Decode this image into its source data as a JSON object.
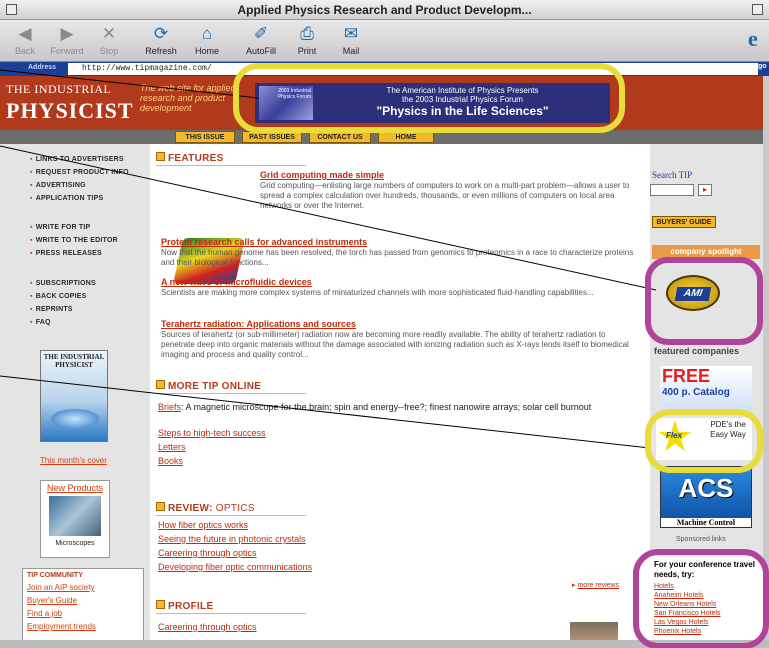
{
  "window": {
    "title": "Applied Physics Research and Product Developm..."
  },
  "toolbar": {
    "back": "Back",
    "forward": "Forward",
    "stop": "Stop",
    "refresh": "Refresh",
    "home": "Home",
    "autofill": "AutoFill",
    "print": "Print",
    "mail": "Mail"
  },
  "address": {
    "label": "Address",
    "url": "http://www.tipmagazine.com/",
    "go": "go"
  },
  "header": {
    "logo_line1": "THE INDUSTRIAL",
    "logo_line2": "PHYSICIST",
    "tagline": "The web site for applied research and product development",
    "banner_small": "2003 Industrial Physics Forum",
    "banner_line1": "The American Institute of Physics Presents",
    "banner_line2": "the 2003 Industrial Physics Forum",
    "banner_line3": "\"Physics in the Life Sciences\""
  },
  "nav": [
    "THIS ISSUE",
    "PAST ISSUES",
    "CONTACT US",
    "HOME"
  ],
  "sidebar": {
    "links_group1": [
      "LINKS TO ADVERTISERS",
      "REQUEST PRODUCT INFO",
      "ADVERTISING",
      "APPLICATION TIPS"
    ],
    "links_group2": [
      "WRITE FOR TIP",
      "WRITE TO THE EDITOR",
      "PRESS RELEASES"
    ],
    "links_group3": [
      "SUBSCRIPTIONS",
      "BACK COPIES",
      "REPRINTS",
      "FAQ"
    ],
    "cover_title": "THE INDUSTRIAL PHYSICIST",
    "cover_caption": "This month's cover",
    "new_products_title": "New Products",
    "new_products_caption": "Microscopes",
    "community_heading": "TIP COMMUNITY",
    "community_links": [
      "Join an AIP society",
      "Buyer's Guide",
      "Find a job",
      "Employment trends"
    ]
  },
  "main": {
    "features_heading": "FEATURES",
    "articles": [
      {
        "title": "Grid computing made simple",
        "desc": "Grid computing—enlisting large numbers of computers to work on a multi-part problem—allows a user to spread a complex calculation over hundreds, thousands, or even millions of computers on local area networks or over the Internet."
      },
      {
        "title": "Protein research calls for advanced instruments",
        "desc": "Now that the human genome has been resolved, the torch has passed from genomics to proteomics in a race to characterize proteins and their biological functions..."
      },
      {
        "title": "A new wave of microfluidic devices",
        "desc": "Scientists are making more complex systems of miniaturized channels with more sophisticated fluid-handling capabilities..."
      },
      {
        "title": "Terahertz radiation: Applications and sources",
        "desc": "Sources of terahertz (or sub-millimeter) radiation now are becoming more readily available. The ability of terahertz radiation to penetrate deep into organic materials without the damage associated with ionizing radiation such as X-rays lends itself to biomedical imaging and process and quality control..."
      }
    ],
    "more_heading": "MORE TIP ONLINE",
    "briefs_link": "Briefs",
    "briefs_text": ": A magnetic microscope for the brain; spin and energy--free?; finest nanowire arrays; solar cell burnout",
    "more_links": [
      "Steps to high-tech success",
      "Letters",
      "Books"
    ],
    "review_heading": "REVIEW:",
    "review_topic": "OPTICS",
    "review_links": [
      "How fiber optics works",
      "Seeing the future in photonic crystals",
      "Careering through optics",
      "Developing fiber optic communications"
    ],
    "more_reviews": "more reviews",
    "profile_heading": "PROFILE",
    "profile_link": "Careering through optics"
  },
  "right": {
    "search_label": "Search TIP",
    "buyers_guide": "BUYERS' GUIDE",
    "company_spotlight": "company spotlight",
    "ami_logo": "AMI",
    "featured_companies": "featured companies",
    "free_text": "FREE",
    "catalog_text": "400 p. Catalog",
    "pde_logo": "Flex",
    "pde_text": "PDE's the Easy Way",
    "acs_logo": "ACS",
    "acs_caption": "Machine Control",
    "sponsored": "Sponsored links",
    "hotels_heading": "For your conference travel needs, try:",
    "hotel_links": [
      "Hotels",
      "Anaheim Hotels",
      "New Orleans Hotels",
      "San Francisco Hotels",
      "Las Vegas Hotels",
      "Phoenix Hotels"
    ]
  },
  "colors": {
    "accent_red": "#b23a1c",
    "link_red": "#c22a0a",
    "nav_gold": "#f4b82d",
    "address_blue": "#1d3e96",
    "highlight_yellow": "#e8dc3a",
    "highlight_magenta": "#b0449a"
  }
}
